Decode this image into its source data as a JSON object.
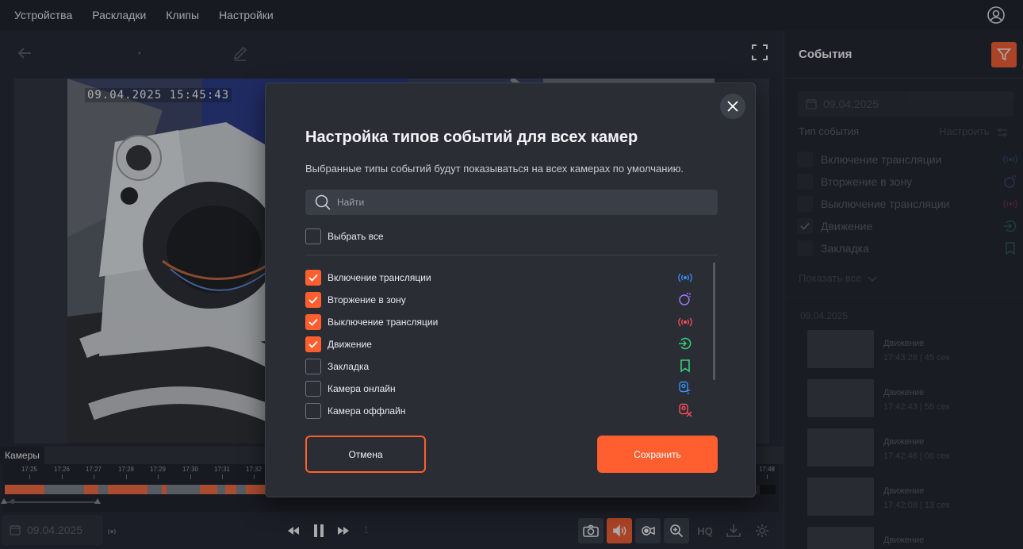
{
  "nav": {
    "items": [
      "Устройства",
      "Раскладки",
      "Клипы",
      "Настройки"
    ]
  },
  "player": {
    "osd_timestamp": "09.04.2025  15:45:43",
    "quality_badge": "HQ",
    "camera_tab": "Камеры",
    "ticks": [
      "17:25",
      "17:26",
      "17:27",
      "17:28",
      "17:29",
      "17:30",
      "17:31",
      "17:32",
      "17:48"
    ],
    "date": "09.04.2025",
    "page_number": "1",
    "quality": "HQ"
  },
  "panel": {
    "title": "События",
    "date": "09.04.2025",
    "event_type_label": "Тип события",
    "configure_label": "Настроить",
    "types": [
      {
        "label": "Включение трансляции",
        "checked": false,
        "icon": "broadcast-on-icon",
        "color": "#3b8ef5"
      },
      {
        "label": "Вторжение в зону",
        "checked": false,
        "icon": "zone-intrusion-icon",
        "color": "#a77bff"
      },
      {
        "label": "Выключение трансляции",
        "checked": false,
        "icon": "broadcast-off-icon",
        "color": "#ff4d5a"
      },
      {
        "label": "Движение",
        "checked": true,
        "icon": "motion-icon",
        "color": "#35d07f"
      },
      {
        "label": "Закладка",
        "checked": false,
        "icon": "bookmark-icon",
        "color": "#35d07f"
      }
    ],
    "show_all": "Показать все",
    "day": "09.04.2025",
    "events": [
      {
        "title": "Движение",
        "time": "17:43:28 | 45 сек"
      },
      {
        "title": "Движение",
        "time": "17:42:43 | 56 сек"
      },
      {
        "title": "Движение",
        "time": "17:42:46 | 06 сек"
      },
      {
        "title": "Движение",
        "time": "17:42:08 | 13 сек"
      },
      {
        "title": "Движение",
        "time": ""
      }
    ]
  },
  "modal": {
    "title": "Настройка типов событий для всех камер",
    "subtitle": "Выбранные типы событий будут показываться на всех камерах по умолчанию.",
    "search_placeholder": "Найти",
    "select_all": "Выбрать все",
    "types": [
      {
        "label": "Включение трансляции",
        "checked": true,
        "icon": "broadcast-on-icon",
        "color": "#3b8ef5"
      },
      {
        "label": "Вторжение в зону",
        "checked": true,
        "icon": "zone-intrusion-icon",
        "color": "#a77bff"
      },
      {
        "label": "Выключение трансляции",
        "checked": true,
        "icon": "broadcast-off-icon",
        "color": "#ff4d5a"
      },
      {
        "label": "Движение",
        "checked": true,
        "icon": "motion-icon",
        "color": "#35d07f"
      },
      {
        "label": "Закладка",
        "checked": false,
        "icon": "bookmark-icon",
        "color": "#35d07f"
      },
      {
        "label": "Камера онлайн",
        "checked": false,
        "icon": "camera-online-icon",
        "color": "#3b8ef5"
      },
      {
        "label": "Камера оффлайн",
        "checked": false,
        "icon": "camera-offline-icon",
        "color": "#ff4d5a"
      }
    ],
    "cancel": "Отмена",
    "save": "Сохранить"
  },
  "colors": {
    "accent": "#ff5e2e",
    "background": "#23262e",
    "panel": "#1f2229",
    "modal": "#2a2d34"
  }
}
